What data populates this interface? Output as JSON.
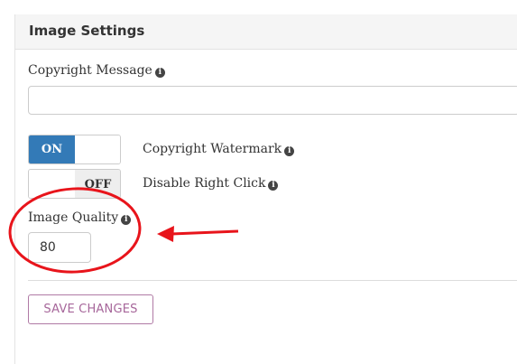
{
  "panel": {
    "title": "Image Settings"
  },
  "fields": {
    "copyright_message": {
      "label": "Copyright Message",
      "value": "",
      "info_icon": "info-circle-icon"
    },
    "copyright_watermark": {
      "label": "Copyright Watermark",
      "state": "ON",
      "on_label": "ON",
      "info_icon": "info-circle-icon"
    },
    "disable_right_click": {
      "label": "Disable Right Click",
      "state": "OFF",
      "off_label": "OFF",
      "info_icon": "info-circle-icon"
    },
    "image_quality": {
      "label": "Image Quality",
      "value": "80",
      "info_icon": "info-circle-icon"
    }
  },
  "actions": {
    "save_label": "SAVE CHANGES"
  },
  "colors": {
    "toggle_on": "#337ab7",
    "toggle_off": "#eeeeee",
    "save_button": "#a6669a",
    "annotation": "#e8141b",
    "header_bg": "#f5f5f5"
  },
  "annotation": {
    "circle_around": "image_quality",
    "arrow_direction": "left"
  }
}
